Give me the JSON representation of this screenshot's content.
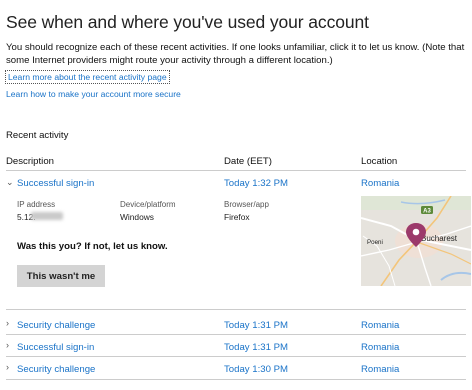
{
  "page": {
    "title": "See when and where you've used your account",
    "description": "You should recognize each of these recent activities. If one looks unfamiliar, click it to let us know. (Note that some Internet providers might route your activity through a different location.)",
    "links": {
      "learn_more": "Learn more about the recent activity page",
      "secure": "Learn how to make your account more secure"
    }
  },
  "activity": {
    "section_title": "Recent activity",
    "columns": {
      "description": "Description",
      "date": "Date (EET)",
      "location": "Location"
    },
    "expanded": {
      "description": "Successful sign-in",
      "date": "Today 1:32 PM",
      "location": "Romania",
      "details": {
        "ip_label": "IP address",
        "ip_value": "5.12.",
        "device_label": "Device/platform",
        "device_value": "Windows",
        "browser_label": "Browser/app",
        "browser_value": "Firefox"
      },
      "prompt": "Was this you? If not, let us know.",
      "button_label": "This wasn't me",
      "map": {
        "city_label": "Bucharest",
        "town_label": "Poeni",
        "road_label": "A3",
        "pin_color": "#9c3a6b"
      }
    },
    "rows": [
      {
        "description": "Security challenge",
        "date": "Today 1:31 PM",
        "location": "Romania"
      },
      {
        "description": "Successful sign-in",
        "date": "Today 1:31 PM",
        "location": "Romania"
      },
      {
        "description": "Security challenge",
        "date": "Today 1:30 PM",
        "location": "Romania"
      }
    ]
  },
  "colors": {
    "link": "#1a73c8",
    "button_bg": "#d4d4d4",
    "divider": "#cccccc"
  }
}
